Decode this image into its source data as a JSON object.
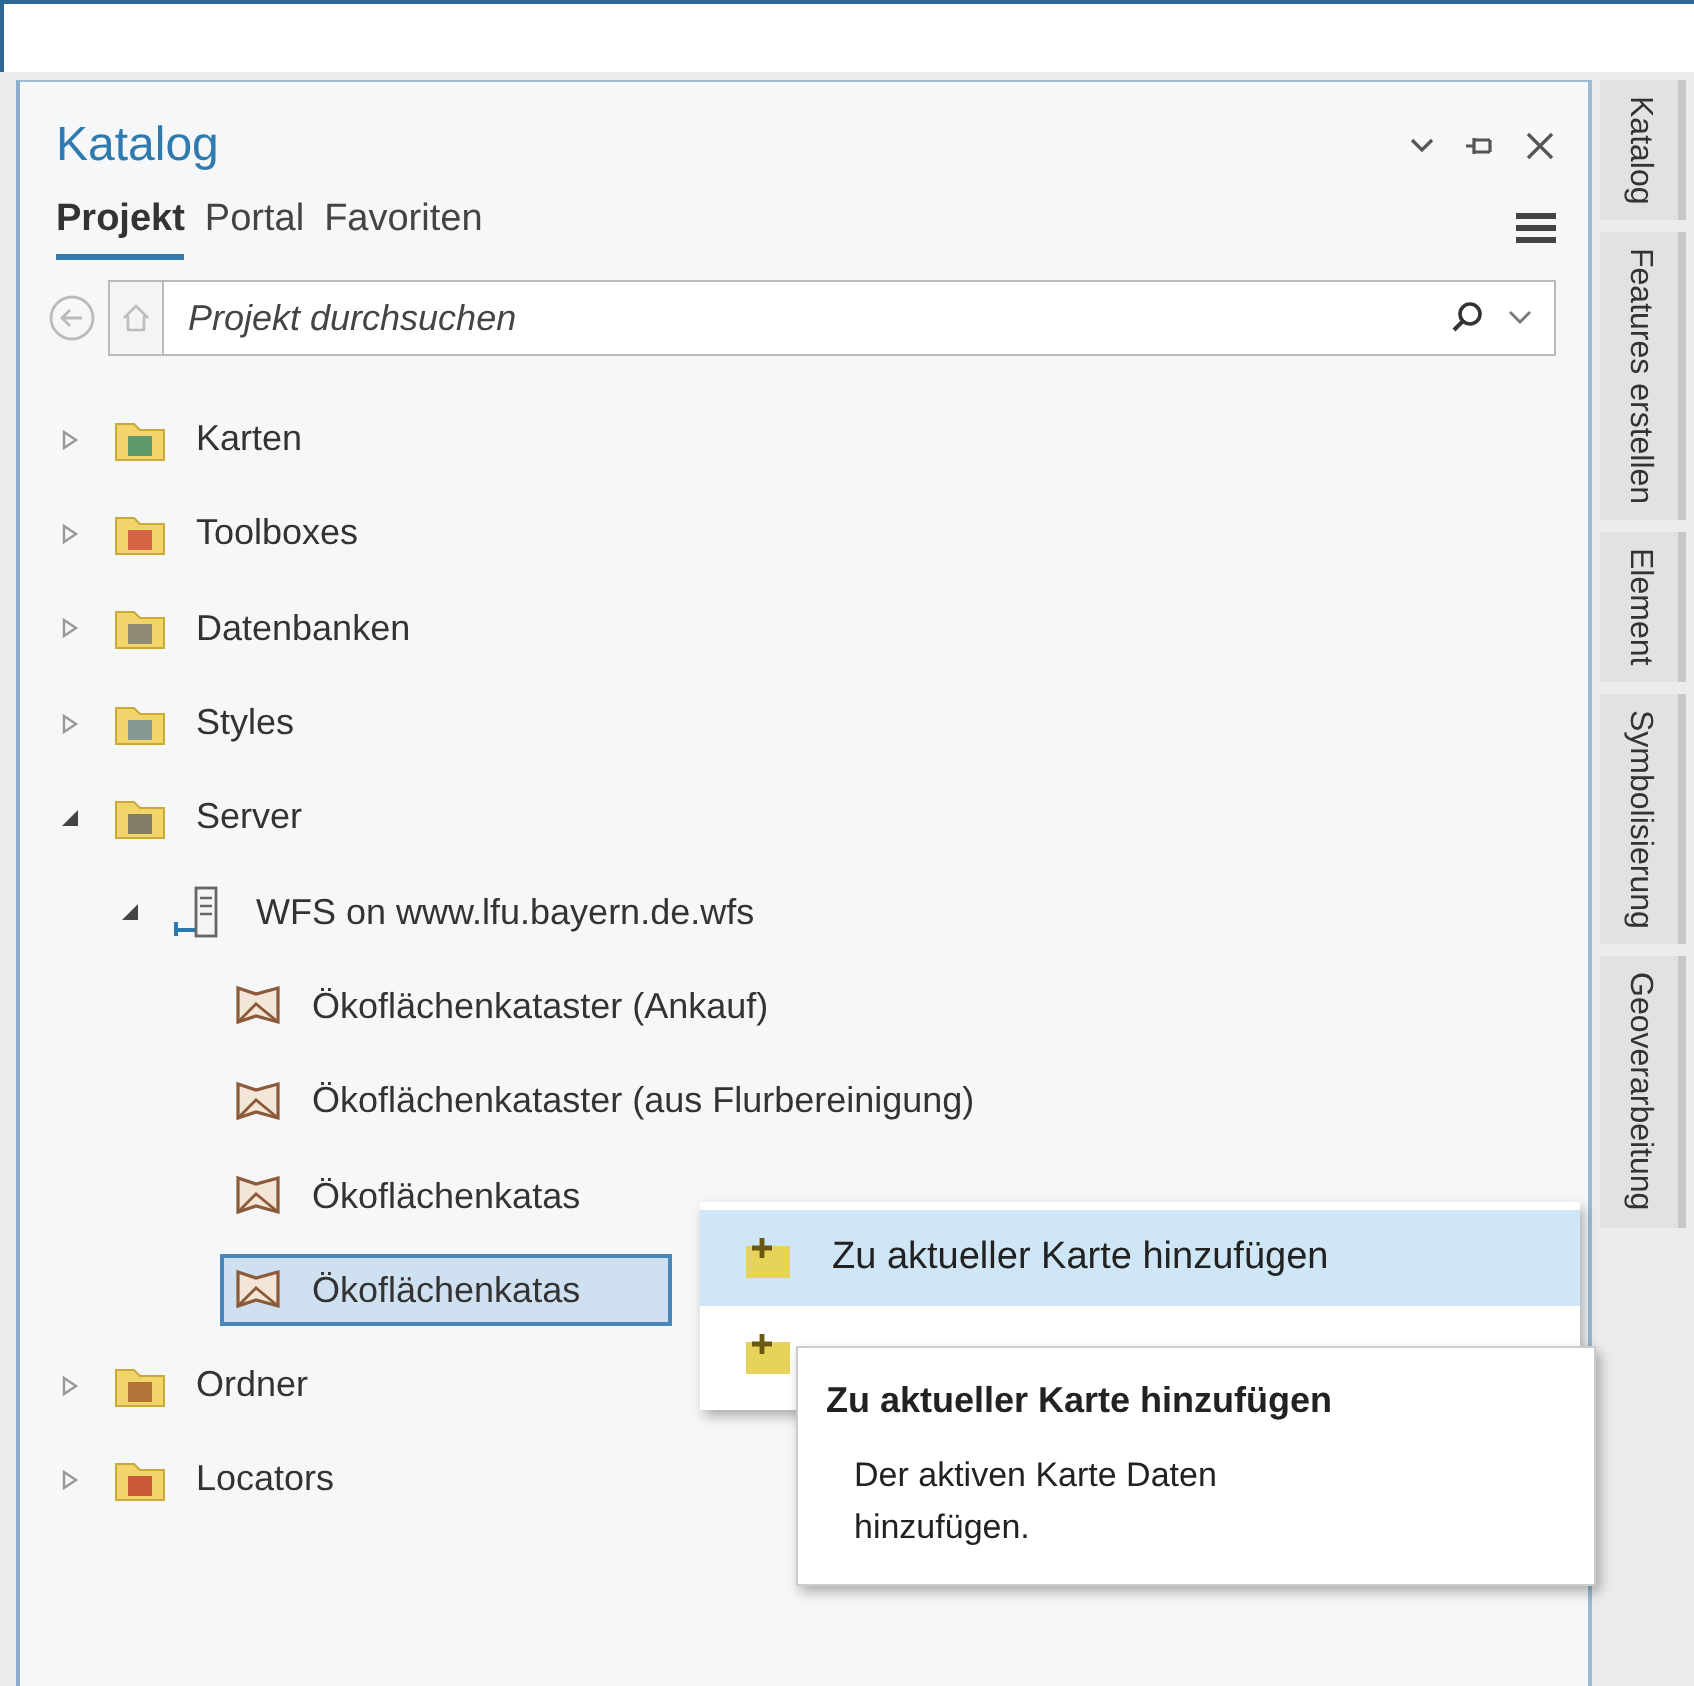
{
  "pane": {
    "title": "Katalog",
    "tabs": [
      {
        "label": "Projekt",
        "selected": true
      },
      {
        "label": "Portal",
        "selected": false
      },
      {
        "label": "Favoriten",
        "selected": false
      }
    ],
    "search": {
      "placeholder": "Projekt durchsuchen"
    }
  },
  "tree": [
    {
      "label": "Karten",
      "kind": "maps",
      "expanded": false,
      "selected": false
    },
    {
      "label": "Toolboxes",
      "kind": "toolbox",
      "expanded": false,
      "selected": false
    },
    {
      "label": "Datenbanken",
      "kind": "database",
      "expanded": false,
      "selected": false
    },
    {
      "label": "Styles",
      "kind": "styles",
      "expanded": false,
      "selected": false
    },
    {
      "label": "Server",
      "kind": "serverfolder",
      "expanded": true,
      "selected": false,
      "children": [
        {
          "label": "WFS on www.lfu.bayern.de.wfs",
          "kind": "server",
          "expanded": true,
          "selected": false,
          "children": [
            {
              "label": "Ökoflächenkataster (Ankauf)",
              "kind": "layer",
              "selected": false
            },
            {
              "label": "Ökoflächenkataster (aus Flurbereinigung)",
              "kind": "layer",
              "selected": false
            },
            {
              "label": "Ökoflächenkatas",
              "kind": "layer",
              "selected": false
            },
            {
              "label": "Ökoflächenkatas",
              "kind": "layer",
              "selected": true
            }
          ]
        }
      ]
    },
    {
      "label": "Ordner",
      "kind": "folder",
      "expanded": false,
      "selected": false
    },
    {
      "label": "Locators",
      "kind": "locator",
      "expanded": false,
      "selected": false
    }
  ],
  "context_menu": [
    {
      "label": "Zu aktueller Karte hinzufügen",
      "selected": true
    },
    {
      "selected": false
    }
  ],
  "tooltip": {
    "title": "Zu aktueller Karte hinzufügen",
    "text": "Der aktiven Karte Daten hinzufügen."
  },
  "side_tabs": [
    "Katalog",
    "Features erstellen",
    "Element",
    "Symbolisierung",
    "Geoverarbeitung"
  ]
}
